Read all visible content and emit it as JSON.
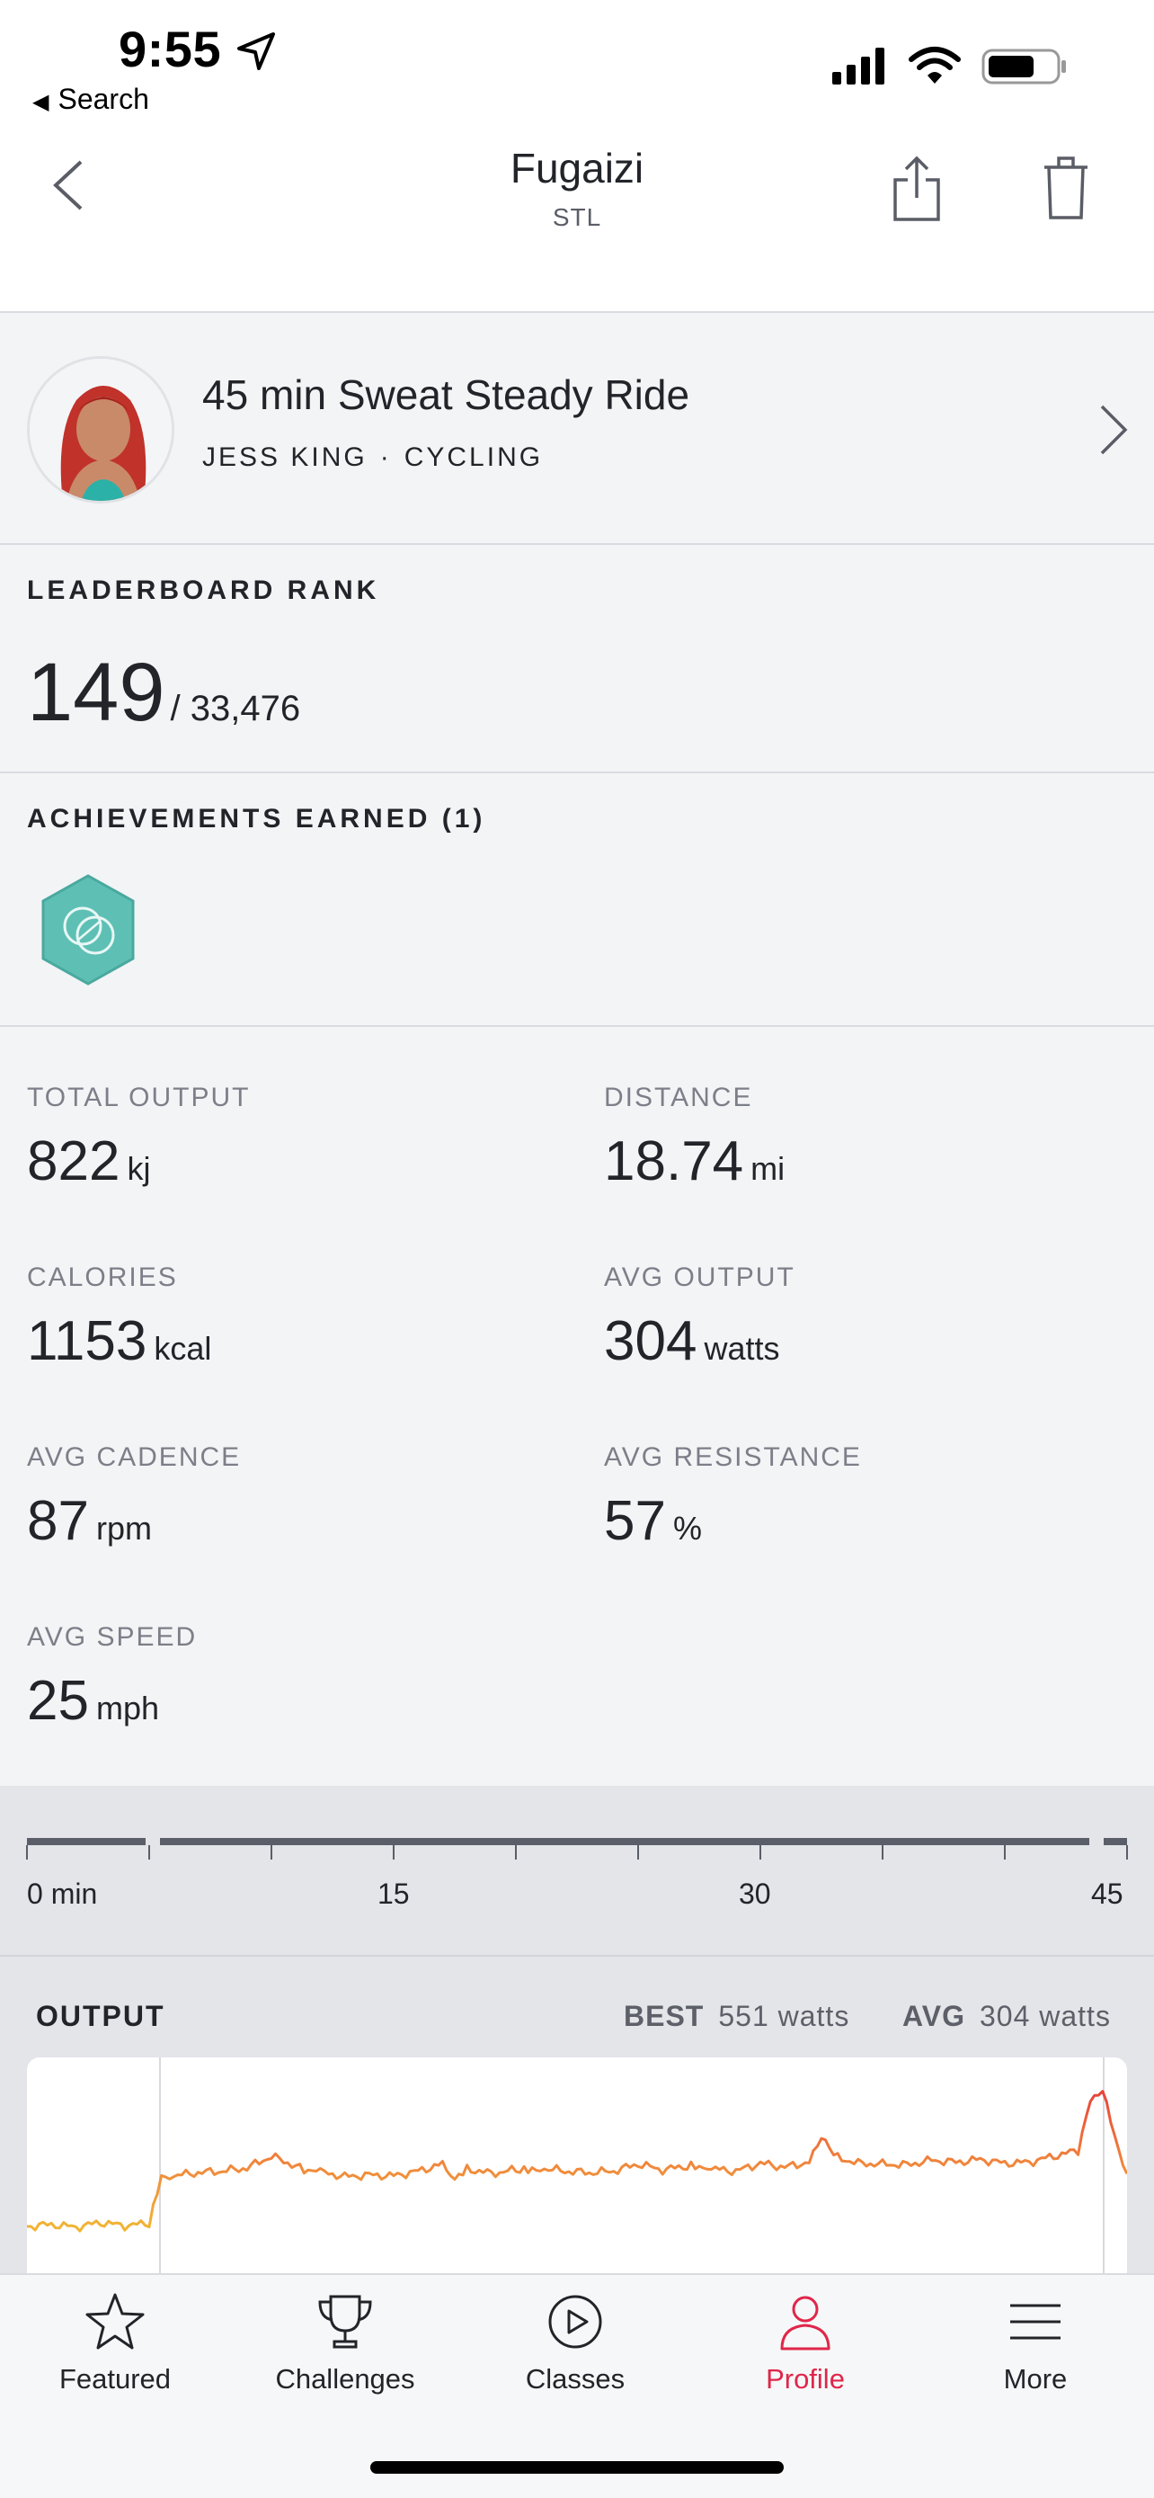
{
  "status_bar": {
    "time": "9:55",
    "back_app": "Search"
  },
  "nav": {
    "title": "Fugaizi",
    "subtitle": "STL"
  },
  "class_info": {
    "title": "45 min Sweat Steady Ride",
    "instructor": "JESS KING",
    "separator": "·",
    "category": "CYCLING"
  },
  "leaderboard": {
    "label": "LEADERBOARD RANK",
    "rank": "149",
    "total": "/ 33,476"
  },
  "achievements": {
    "label": "ACHIEVEMENTS EARNED (1)"
  },
  "metrics": [
    {
      "label": "TOTAL OUTPUT",
      "value": "822",
      "unit": "kj"
    },
    {
      "label": "DISTANCE",
      "value": "18.74",
      "unit": "mi"
    },
    {
      "label": "CALORIES",
      "value": "1153",
      "unit": "kcal"
    },
    {
      "label": "AVG OUTPUT",
      "value": "304",
      "unit": "watts"
    },
    {
      "label": "AVG CADENCE",
      "value": "87",
      "unit": "rpm"
    },
    {
      "label": "AVG RESISTANCE",
      "value": "57",
      "unit": "%"
    },
    {
      "label": "AVG SPEED",
      "value": "25",
      "unit": "mph"
    }
  ],
  "timeline": {
    "labels": [
      "0 min",
      "15",
      "30",
      "45"
    ]
  },
  "output": {
    "label": "OUTPUT",
    "best_label": "BEST",
    "best_value": "551 watts",
    "avg_label": "AVG",
    "avg_value": "304 watts"
  },
  "tabs": [
    {
      "label": "Featured",
      "icon": "star-icon",
      "active": false
    },
    {
      "label": "Challenges",
      "icon": "trophy-icon",
      "active": false
    },
    {
      "label": "Classes",
      "icon": "play-circle-icon",
      "active": false
    },
    {
      "label": "Profile",
      "icon": "person-icon",
      "active": true
    },
    {
      "label": "More",
      "icon": "menu-icon",
      "active": false
    }
  ],
  "colors": {
    "accent": "#e0264a",
    "badge": "#5ec0b5",
    "line_low": "#f2b632",
    "line_mid": "#f08a3c",
    "line_peak": "#e8433a"
  },
  "chart_data": {
    "type": "line",
    "title": "",
    "xlabel": "",
    "ylabel": "",
    "xlim": [
      0,
      45
    ],
    "series": [
      {
        "name": "OUTPUT",
        "x": [
          0,
          1,
          2,
          3,
          4,
          5,
          5.5,
          6,
          7,
          8,
          9,
          10,
          11,
          11.5,
          12,
          13,
          14,
          15,
          16,
          17,
          17.5,
          18,
          19,
          20,
          20.5,
          21,
          22,
          23,
          24,
          25,
          26,
          27,
          27.5,
          28,
          29,
          30,
          31,
          32,
          32.5,
          33,
          34,
          35,
          36,
          37,
          38,
          39,
          40,
          41,
          42,
          43,
          43.5,
          44,
          44.5,
          45
        ],
        "y": [
          120,
          125,
          118,
          130,
          122,
          128,
          245,
          250,
          258,
          262,
          270,
          300,
          275,
          265,
          260,
          248,
          252,
          250,
          262,
          280,
          240,
          268,
          256,
          265,
          262,
          270,
          262,
          258,
          262,
          280,
          265,
          275,
          272,
          268,
          262,
          282,
          272,
          285,
          355,
          300,
          282,
          280,
          278,
          290,
          285,
          292,
          282,
          285,
          300,
          315,
          440,
          475,
          345,
          255
        ]
      }
    ]
  }
}
